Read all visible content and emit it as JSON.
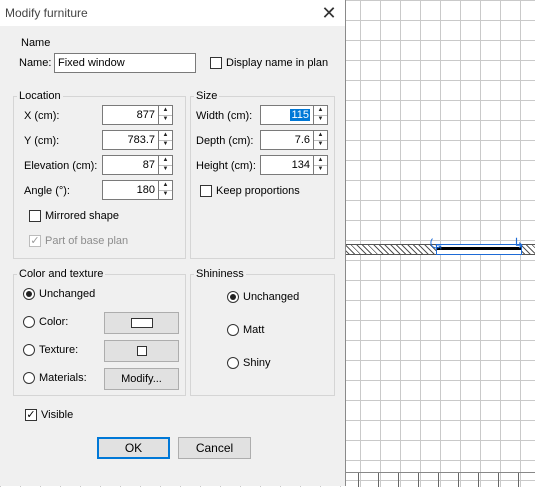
{
  "dialog": {
    "title": "Modify furniture",
    "name_group": {
      "legend": "Name",
      "name_label": "Name:",
      "name_value": "Fixed window",
      "display_in_plan_label": "Display name in plan",
      "display_in_plan_checked": false
    },
    "location": {
      "legend": "Location",
      "x_label": "X (cm):",
      "x_value": "877",
      "y_label": "Y (cm):",
      "y_value": "783.7",
      "elevation_label": "Elevation (cm):",
      "elevation_value": "87",
      "angle_label": "Angle (°):",
      "angle_value": "180",
      "mirrored_label": "Mirrored shape",
      "mirrored_checked": false,
      "base_plan_label": "Part of base plan",
      "base_plan_checked": true
    },
    "size": {
      "legend": "Size",
      "width_label": "Width (cm):",
      "width_value": "115",
      "depth_label": "Depth (cm):",
      "depth_value": "7.6",
      "height_label": "Height (cm):",
      "height_value": "134",
      "keep_proportions_label": "Keep proportions",
      "keep_proportions_checked": false
    },
    "color_texture": {
      "legend": "Color and texture",
      "unchanged_label": "Unchanged",
      "color_label": "Color:",
      "texture_label": "Texture:",
      "materials_label": "Materials:",
      "modify_button": "Modify...",
      "selected": "Unchanged"
    },
    "shininess": {
      "legend": "Shininess",
      "unchanged_label": "Unchanged",
      "matt_label": "Matt",
      "shiny_label": "Shiny",
      "selected": "Unchanged"
    },
    "visible_label": "Visible",
    "visible_checked": true,
    "ok_button": "OK",
    "cancel_button": "Cancel"
  },
  "colors": {
    "dialog_bg": "#f0f0f0",
    "selection": "#0078d7",
    "plan_selection": "#1e6bd6"
  },
  "icons": [
    "close-icon",
    "spin-up-icon",
    "spin-down-icon",
    "check-icon",
    "color-swatch-icon",
    "texture-swatch-icon",
    "rotate-handle-icon",
    "resize-handle-icon"
  ]
}
